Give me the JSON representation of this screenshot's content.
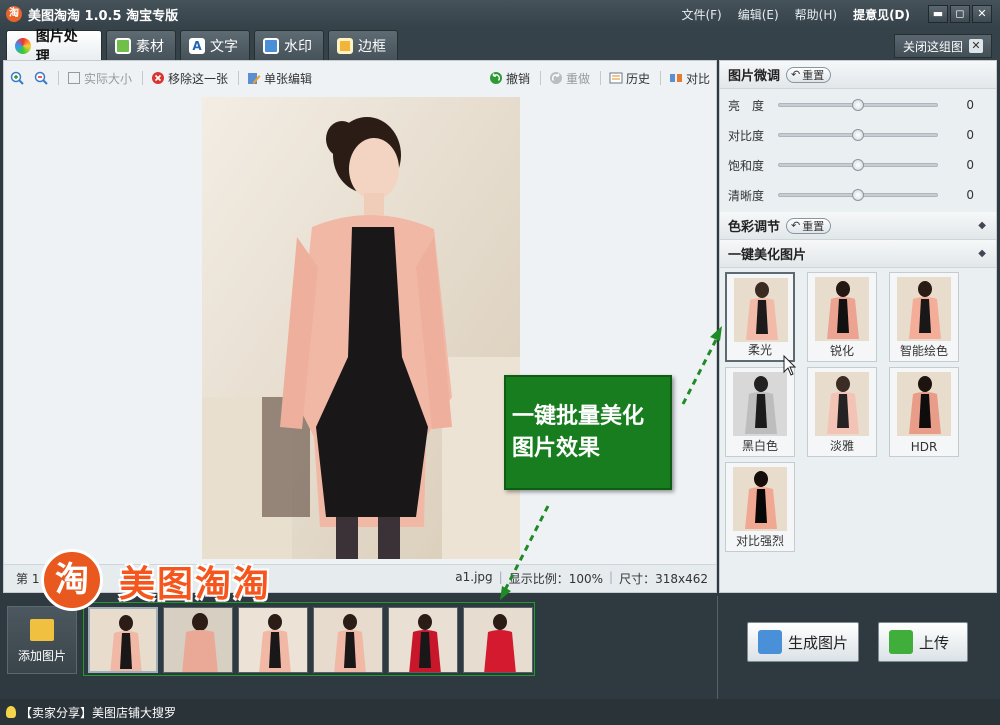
{
  "window": {
    "title": "美图淘淘 1.0.5 淘宝专版",
    "menu": [
      "文件(F)",
      "编辑(E)",
      "帮助(H)"
    ],
    "feedback": "提意见(D)",
    "min": "▬",
    "max": "◻",
    "close": "✕"
  },
  "tabs": [
    "图片处理",
    "素材",
    "文字",
    "水印",
    "边框"
  ],
  "close_group": "关闭这组图",
  "toolbar": {
    "zoom_in": "",
    "zoom_out": "",
    "actual_size": "实际大小",
    "remove": "移除这一张",
    "single_edit": "单张编辑",
    "undo": "撤销",
    "redo": "重做",
    "history": "历史",
    "compare": "对比"
  },
  "status_line": {
    "page": "第 1",
    "filename": "a1.jpg",
    "ratio": "显示比例：100%",
    "size": "尺寸：318x462"
  },
  "panel": {
    "fine_tune": {
      "title": "图片微调",
      "reset": "重置",
      "sliders": [
        {
          "label": "亮　度",
          "value": "0",
          "level": 0.5
        },
        {
          "label": "对比度",
          "value": "0",
          "level": 0.5
        },
        {
          "label": "饱和度",
          "value": "0",
          "level": 0.5
        },
        {
          "label": "清晰度",
          "value": "0",
          "level": 0.5
        }
      ]
    },
    "color": {
      "title": "色彩调节",
      "reset": "重置"
    },
    "beautify": {
      "title": "一键美化图片",
      "effects": [
        "柔光",
        "锐化",
        "智能绘色",
        "黑白色",
        "淡雅",
        "HDR",
        "对比强烈"
      ]
    }
  },
  "callout": {
    "line1": "一键批量美化",
    "line2": "图片效果"
  },
  "brand": {
    "logo": "淘",
    "text": "美图淘淘"
  },
  "strip": {
    "add_label": "添加图片",
    "generate": "生成图片",
    "upload": "上传"
  },
  "statusbar": {
    "text": "【卖家分享】美图店铺大搜罗"
  },
  "colors": {
    "accent_green": "#177d1f",
    "brand_orange": "#f4561e"
  }
}
